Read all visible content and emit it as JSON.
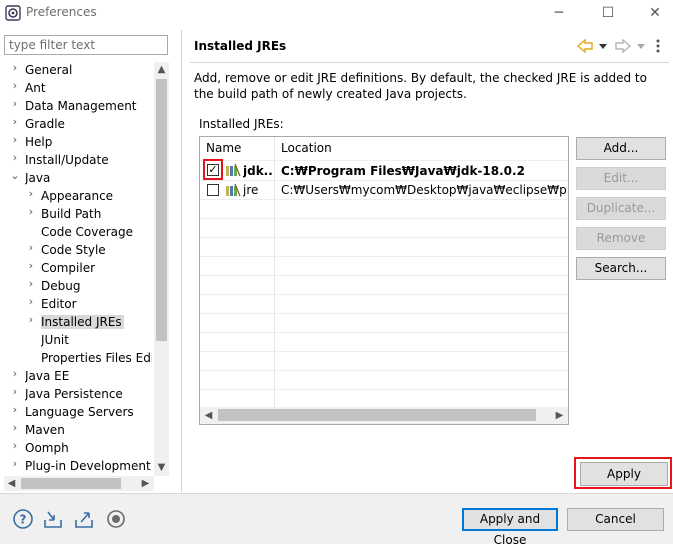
{
  "window": {
    "title": "Preferences",
    "minimize": "─",
    "maximize": "☐",
    "close": "✕"
  },
  "filter": {
    "placeholder": "type filter text",
    "value": ""
  },
  "tree": {
    "items": [
      {
        "label": "General",
        "twisty": "›",
        "level": 0
      },
      {
        "label": "Ant",
        "twisty": "›",
        "level": 0
      },
      {
        "label": "Data Management",
        "twisty": "›",
        "level": 0
      },
      {
        "label": "Gradle",
        "twisty": "›",
        "level": 0
      },
      {
        "label": "Help",
        "twisty": "›",
        "level": 0
      },
      {
        "label": "Install/Update",
        "twisty": "›",
        "level": 0
      },
      {
        "label": "Java",
        "twisty": "⌄",
        "level": 0
      },
      {
        "label": "Appearance",
        "twisty": "›",
        "level": 1
      },
      {
        "label": "Build Path",
        "twisty": "›",
        "level": 1
      },
      {
        "label": "Code Coverage",
        "twisty": "",
        "level": 1
      },
      {
        "label": "Code Style",
        "twisty": "›",
        "level": 1
      },
      {
        "label": "Compiler",
        "twisty": "›",
        "level": 1
      },
      {
        "label": "Debug",
        "twisty": "›",
        "level": 1
      },
      {
        "label": "Editor",
        "twisty": "›",
        "level": 1
      },
      {
        "label": "Installed JREs",
        "twisty": "›",
        "level": 1,
        "selected": true
      },
      {
        "label": "JUnit",
        "twisty": "",
        "level": 1
      },
      {
        "label": "Properties Files Edito",
        "twisty": "",
        "level": 1
      },
      {
        "label": "Java EE",
        "twisty": "›",
        "level": 0
      },
      {
        "label": "Java Persistence",
        "twisty": "›",
        "level": 0
      },
      {
        "label": "Language Servers",
        "twisty": "›",
        "level": 0
      },
      {
        "label": "Maven",
        "twisty": "›",
        "level": 0
      },
      {
        "label": "Oomph",
        "twisty": "›",
        "level": 0
      },
      {
        "label": "Plug-in Development",
        "twisty": "›",
        "level": 0
      }
    ]
  },
  "page": {
    "title": "Installed JREs",
    "description": "Add, remove or edit JRE definitions. By default, the checked JRE is added to the build path of newly created Java projects.",
    "table_label": "Installed JREs:",
    "columns": [
      "Name",
      "Location"
    ],
    "rows": [
      {
        "name": "jdk...",
        "location": "C:₩Program Files₩Java₩jdk-18.0.2",
        "checked": true,
        "bold": true
      },
      {
        "name": "jre",
        "location": "C:₩Users₩mycom₩Desktop₩java₩eclipse₩plugins₩o",
        "checked": false,
        "bold": false
      }
    ]
  },
  "buttons": {
    "add": "Add...",
    "edit": "Edit...",
    "duplicate": "Duplicate...",
    "remove": "Remove",
    "search": "Search...",
    "apply": "Apply",
    "apply_close": "Apply and Close",
    "cancel": "Cancel"
  },
  "icons": {
    "app": "eclipse-icon",
    "back": "back-arrow-icon",
    "forward": "forward-arrow-icon",
    "menu": "view-menu-icon",
    "help": "help-icon",
    "import": "import-icon",
    "export": "export-icon",
    "record": "record-icon"
  },
  "colors": {
    "highlight": "#e8141b",
    "accent": "#0078d7",
    "nav_arrow": "#e6a817"
  }
}
